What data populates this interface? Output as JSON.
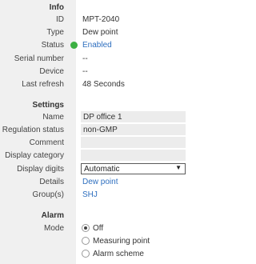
{
  "info": {
    "header": "Info",
    "id": {
      "label": "ID",
      "value": "MPT-2040"
    },
    "type": {
      "label": "Type",
      "value": "Dew point"
    },
    "status": {
      "label": "Status",
      "value": "Enabled",
      "color": "#3cb043"
    },
    "serial_number": {
      "label": "Serial number",
      "value": "--"
    },
    "device": {
      "label": "Device",
      "value": "--"
    },
    "last_refresh": {
      "label": "Last refresh",
      "value": "48 Seconds"
    }
  },
  "settings": {
    "header": "Settings",
    "name": {
      "label": "Name",
      "value": "DP office 1"
    },
    "regulation_status": {
      "label": "Regulation status",
      "value": "non-GMP"
    },
    "comment": {
      "label": "Comment",
      "value": ""
    },
    "display_category": {
      "label": "Display category",
      "value": ""
    },
    "display_digits": {
      "label": "Display digits",
      "value": "Automatic"
    },
    "details": {
      "label": "Details",
      "value": "Dew point"
    },
    "groups": {
      "label": "Group(s)",
      "value": "SHJ"
    }
  },
  "alarm": {
    "header": "Alarm",
    "mode": {
      "label": "Mode",
      "options": [
        "Off",
        "Measuring point",
        "Alarm scheme"
      ],
      "selected": "Off"
    }
  },
  "colors": {
    "link": "#2e6fbf",
    "sidebar": "#f0f0f0",
    "field": "#ececec"
  }
}
